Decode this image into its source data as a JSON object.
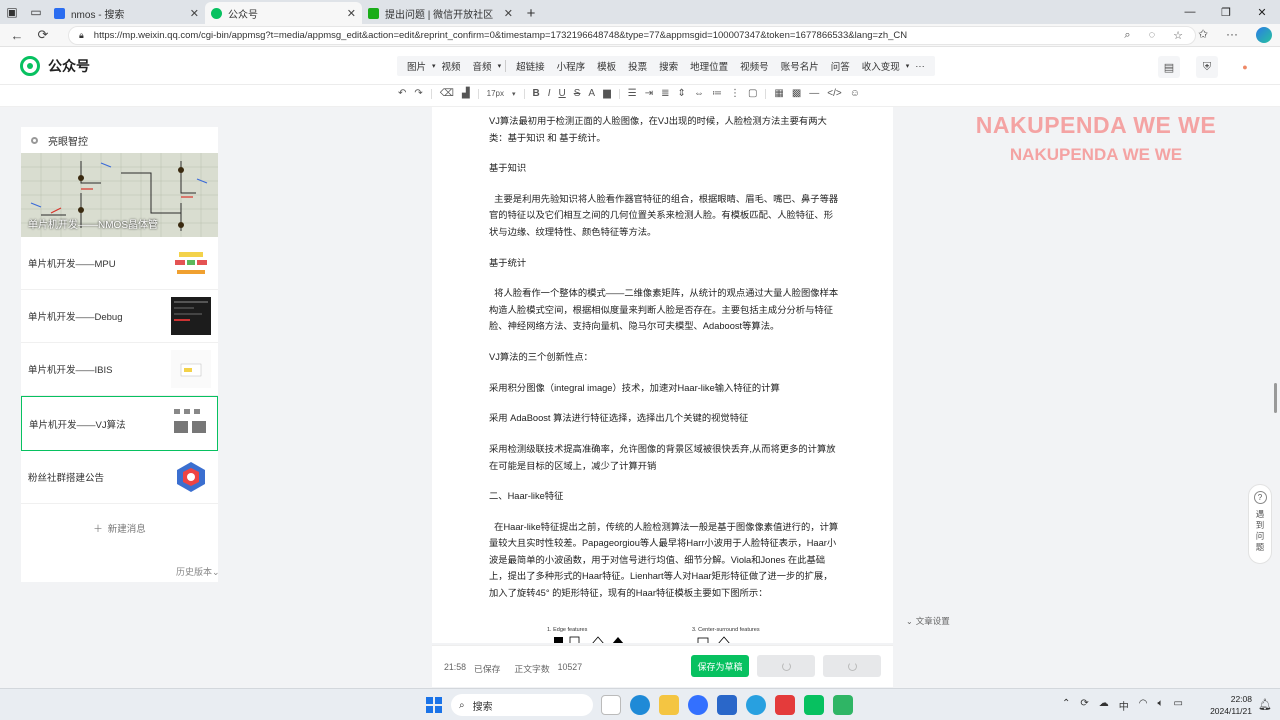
{
  "browser": {
    "tabs": [
      {
        "label": "nmos - 搜索",
        "favicon_color": "#2b6df0",
        "active": false
      },
      {
        "label": "公众号",
        "favicon_color": "#07c160",
        "active": true
      },
      {
        "label": "提出问题 | 微信开放社区",
        "favicon_color": "#1aad19",
        "active": false
      }
    ],
    "url": "https://mp.weixin.qq.com/cgi-bin/appmsg?t=media/appmsg_edit&action=edit&reprint_confirm=0&timestamp=1732196648748&type=77&appmsgid=100007347&token=1677866533&lang=zh_CN"
  },
  "app": {
    "title": "公众号",
    "insert_menu": [
      "图片",
      "视频",
      "音频",
      "超链接",
      "小程序",
      "模板",
      "投票",
      "搜索",
      "地理位置",
      "视频号",
      "账号名片",
      "问答",
      "收入变现",
      "···"
    ],
    "font_size": "17px"
  },
  "sidebar": {
    "account_name": "亮眼智控",
    "cover_title": "单片机开发——NMOS晶体管",
    "articles": [
      {
        "label": "单片机开发——MPU",
        "selected": false
      },
      {
        "label": "单片机开发——Debug",
        "selected": false
      },
      {
        "label": "单片机开发——IBIS",
        "selected": false
      },
      {
        "label": "单片机开发——VJ算法",
        "selected": true
      },
      {
        "label": "粉丝社群搭建公告",
        "selected": false
      }
    ],
    "new_message": "新建消息",
    "history": "历史版本"
  },
  "document": {
    "paragraphs": [
      "VJ算法最初用于检测正面的人脸图像，在VJ出现的时候，人脸检测方法主要有两大类：基于知识 和 基于统计。",
      "基于知识",
      "  主要是利用先验知识将人脸看作器官特征的组合，根据眼睛、眉毛、嘴巴、鼻子等器官的特征以及它们相互之间的几何位置关系来检测人脸。有模板匹配、人脸特征、形状与边缘、纹理特性、颜色特征等方法。",
      "基于统计",
      "  将人脸看作一个整体的模式——二维像素矩阵，从统计的观点通过大量人脸图像样本构造人脸模式空间，根据相似度量来判断人脸是否存在。主要包括主成分分析与特征脸、神经网络方法、支持向量机、隐马尔可夫模型、Adaboost等算法。",
      "VJ算法的三个创新性点：",
      "采用积分图像（integral image）技术，加速对Haar-like输入特征的计算",
      "采用 AdaBoost 算法进行特征选择，选择出几个关键的视觉特征",
      "采用检测级联技术提高准确率，允许图像的背景区域被很快丢弃,从而将更多的计算放在可能是目标的区域上，减少了计算开销",
      "二、Haar-like特征",
      "  在Haar-like特征提出之前，传统的人脸检测算法一般是基于图像像素值进行的，计算量较大且实时性较差。Papageorgiou等人最早将Harr小波用于人脸特征表示，Haar小波是最简单的小波函数，用于对信号进行均值、细节分解。Viola和Jones 在此基础上，提出了多种形式的Haar特征。Lienhart等人对Haar矩形特征做了进一步的扩展，加入了旋转45° 的矩形特征，现有的Haar特征模板主要如下图所示："
    ],
    "figure_labels": [
      "1. Edge features",
      "3. Center-surround features"
    ]
  },
  "footer": {
    "time": "21:58",
    "status": "已保存",
    "word_count_label": "正文字数",
    "word_count": "10527",
    "save_draft": "保存为草稿"
  },
  "side": {
    "watermark_line1": "NAKUPENDA WE WE",
    "watermark_line2": "NAKUPENDA WE WE",
    "help_label": "遇到问题",
    "doc_setting": "文章设置"
  },
  "taskbar": {
    "search_label": "搜索",
    "time": "22:08",
    "date": "2024/11/21"
  }
}
